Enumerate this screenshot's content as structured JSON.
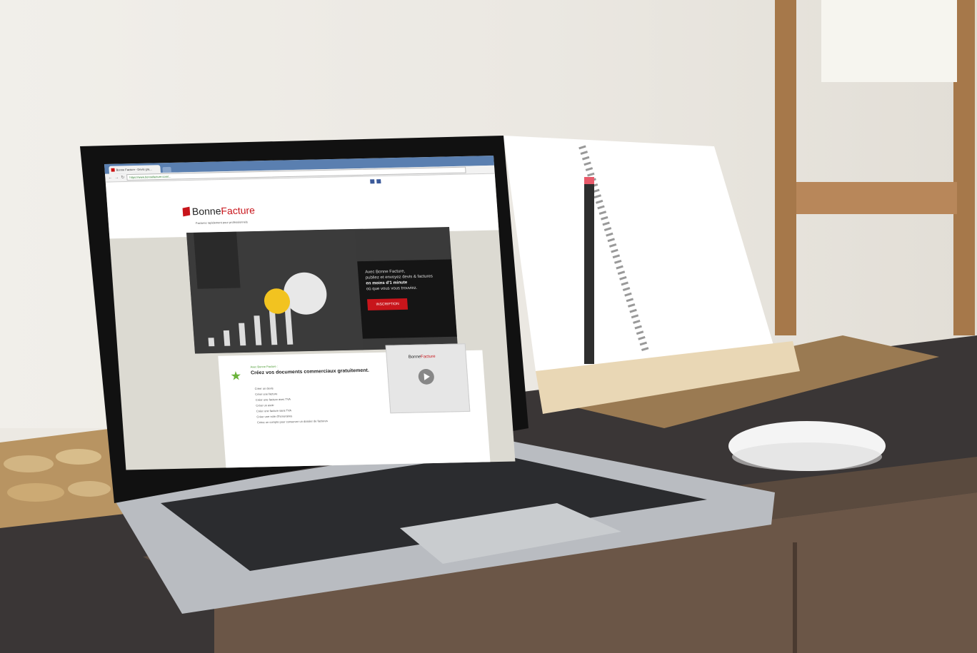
{
  "browser": {
    "tab_title": "Bonne Facture - Devis gra...",
    "url": "https://www.bonnefacture.com/..."
  },
  "site": {
    "logo_prefix": "Bonne",
    "logo_suffix": "Facture",
    "tagline": "Facturez rapidement pour professionnels",
    "hero_line1": "Avec Bonne Facture,",
    "hero_line2": "publiez et envoyez devis & factures",
    "hero_strong": "en moins d'1 minute",
    "hero_line3": "où que vous vous trouviez.",
    "hero_button": "INSCRIPTION",
    "kicker": "Avec Bonne Facture :",
    "headline": "Créez vos documents commerciaux gratuitement.",
    "list_items": [
      "Créer un devis",
      "Créer une facture",
      "Créer une facture avec TVA",
      "Créer un avoir",
      "Créer une facture sans TVA",
      "Créer une note d'honoraires",
      "Créez un compte pour conserver un dossier de factures"
    ],
    "video_logo_prefix": "Bonne",
    "video_logo_suffix": "Facture"
  },
  "colors": {
    "brand_red": "#c8151b",
    "accent_green": "#6ab33a"
  },
  "icons": [
    "facebook-icon",
    "twitter-icon",
    "star-icon",
    "play-icon"
  ]
}
